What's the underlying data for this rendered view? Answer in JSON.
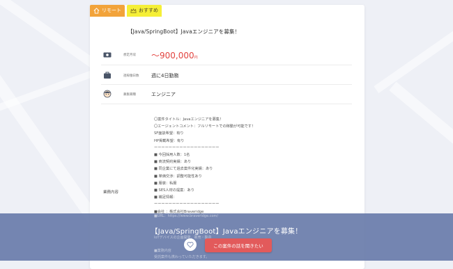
{
  "tags": {
    "remote": "リモート",
    "recommend": "おすすめ"
  },
  "job": {
    "title": "【Java/SpringBoot】Javaエンジニアを募集！"
  },
  "rows": [
    {
      "label": "想定月収",
      "value": "〜900,000",
      "unit": "円",
      "icon": "money-icon"
    },
    {
      "label": "週稼働日数",
      "value": "週に4日勤務",
      "icon": "bag-icon"
    },
    {
      "label": "募集職種",
      "value": "エンジニア",
      "icon": "person-icon"
    }
  ],
  "description": {
    "label": "業務内容",
    "lines": [
      "〇案件タイトル：Javaエンジニアを募集！",
      "〇エージェントコメント：フルリモートでの稼動が可能です！",
      "SF面談希望：有り",
      "HP掲載希望：有り",
      "ーーーーーーーーーーーーーーーーーー",
      "■ 今回採用人数：1名",
      "■ 商流契約実績：あり",
      "■ 同企業にて過去案件化実績：あり",
      "■ 単価交渉：調整可能性あり",
      "■ 服装：私服",
      "■ SES人材の提案：あり",
      "■ 補足情報：",
      "ーーーーーーーーーーーーーーーーーー",
      "■会社 ：株式会社Braveridge"
    ],
    "faded_lines": [
      "■URL：https://www.braveridge.com/",
      "IoTデバイスの企画開発、販売・製造",
      "■業務内容",
      "受託案件も携わっていただきます。"
    ]
  },
  "cta": {
    "title": "【Java/SpringBoot】Javaエンジニアを募集！",
    "apply_label": "この案件の話を聞きたい"
  },
  "colors": {
    "accent_red": "#e2433f",
    "tag_remote": "#f2a33a",
    "tag_recommend": "#f5ef37",
    "cta_bar": "#6b7dab",
    "apply_button": "#e25a5b"
  }
}
